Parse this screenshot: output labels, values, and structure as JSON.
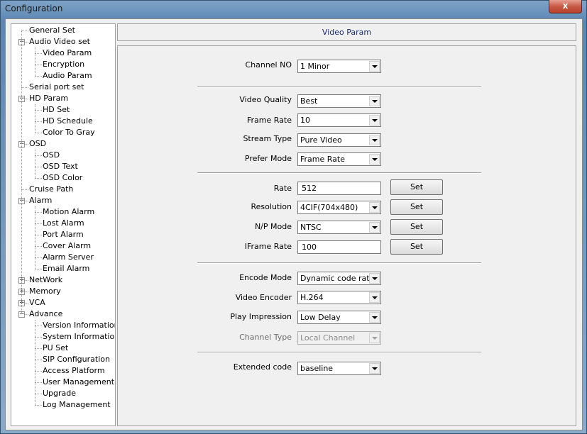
{
  "window": {
    "title": "Configuration",
    "close_glyph": "x"
  },
  "tree": [
    {
      "label": "General Set",
      "level": 0,
      "toggle": null
    },
    {
      "label": "Audio Video set",
      "level": 0,
      "toggle": "-"
    },
    {
      "label": "Video Param",
      "level": 1,
      "toggle": null
    },
    {
      "label": "Encryption",
      "level": 1,
      "toggle": null
    },
    {
      "label": "Audio Param",
      "level": 1,
      "toggle": null
    },
    {
      "label": "Serial port set",
      "level": 0,
      "toggle": null
    },
    {
      "label": "HD Param",
      "level": 0,
      "toggle": "-"
    },
    {
      "label": "HD Set",
      "level": 1,
      "toggle": null
    },
    {
      "label": "HD Schedule",
      "level": 1,
      "toggle": null
    },
    {
      "label": "Color To Gray",
      "level": 1,
      "toggle": null
    },
    {
      "label": "OSD",
      "level": 0,
      "toggle": "-"
    },
    {
      "label": "OSD",
      "level": 1,
      "toggle": null
    },
    {
      "label": "OSD Text",
      "level": 1,
      "toggle": null
    },
    {
      "label": "OSD Color",
      "level": 1,
      "toggle": null
    },
    {
      "label": "Cruise Path",
      "level": 0,
      "toggle": null
    },
    {
      "label": "Alarm",
      "level": 0,
      "toggle": "-"
    },
    {
      "label": "Motion Alarm",
      "level": 1,
      "toggle": null
    },
    {
      "label": "Lost Alarm",
      "level": 1,
      "toggle": null
    },
    {
      "label": "Port Alarm",
      "level": 1,
      "toggle": null
    },
    {
      "label": "Cover Alarm",
      "level": 1,
      "toggle": null
    },
    {
      "label": "Alarm Server",
      "level": 1,
      "toggle": null
    },
    {
      "label": "Email Alarm",
      "level": 1,
      "toggle": null
    },
    {
      "label": "NetWork",
      "level": 0,
      "toggle": "+"
    },
    {
      "label": "Memory",
      "level": 0,
      "toggle": "+"
    },
    {
      "label": "VCA",
      "level": 0,
      "toggle": "+"
    },
    {
      "label": "Advance",
      "level": 0,
      "toggle": "-"
    },
    {
      "label": "Version Information",
      "level": 1,
      "toggle": null
    },
    {
      "label": "System Information",
      "level": 1,
      "toggle": null
    },
    {
      "label": "PU Set",
      "level": 1,
      "toggle": null
    },
    {
      "label": "SIP Configuration",
      "level": 1,
      "toggle": null
    },
    {
      "label": "Access Platform",
      "level": 1,
      "toggle": null
    },
    {
      "label": "User Management",
      "level": 1,
      "toggle": null
    },
    {
      "label": "Upgrade",
      "level": 1,
      "toggle": null
    },
    {
      "label": "Log Management",
      "level": 1,
      "toggle": null
    }
  ],
  "header": {
    "title": "Video Param"
  },
  "form": {
    "channel_no": {
      "label": "Channel NO",
      "value": "1 Minor"
    },
    "video_quality": {
      "label": "Video Quality",
      "value": "Best"
    },
    "frame_rate": {
      "label": "Frame Rate",
      "value": "10"
    },
    "stream_type": {
      "label": "Stream Type",
      "value": "Pure Video"
    },
    "prefer_mode": {
      "label": "Prefer Mode",
      "value": "Frame Rate"
    },
    "rate": {
      "label": "Rate",
      "value": "512"
    },
    "resolution": {
      "label": "Resolution",
      "value": "4CIF(704x480)"
    },
    "np_mode": {
      "label": "N/P Mode",
      "value": "NTSC"
    },
    "iframe_rate": {
      "label": "IFrame Rate",
      "value": "100"
    },
    "encode_mode": {
      "label": "Encode Mode",
      "value": "Dynamic code rate"
    },
    "video_encoder": {
      "label": "Video Encoder",
      "value": "H.264"
    },
    "play_impression": {
      "label": "Play Impression",
      "value": "Low Delay"
    },
    "channel_type": {
      "label": "Channel Type",
      "value": "Local Channel"
    },
    "extended_code": {
      "label": "Extended code",
      "value": "baseline"
    },
    "set_label": "Set"
  }
}
